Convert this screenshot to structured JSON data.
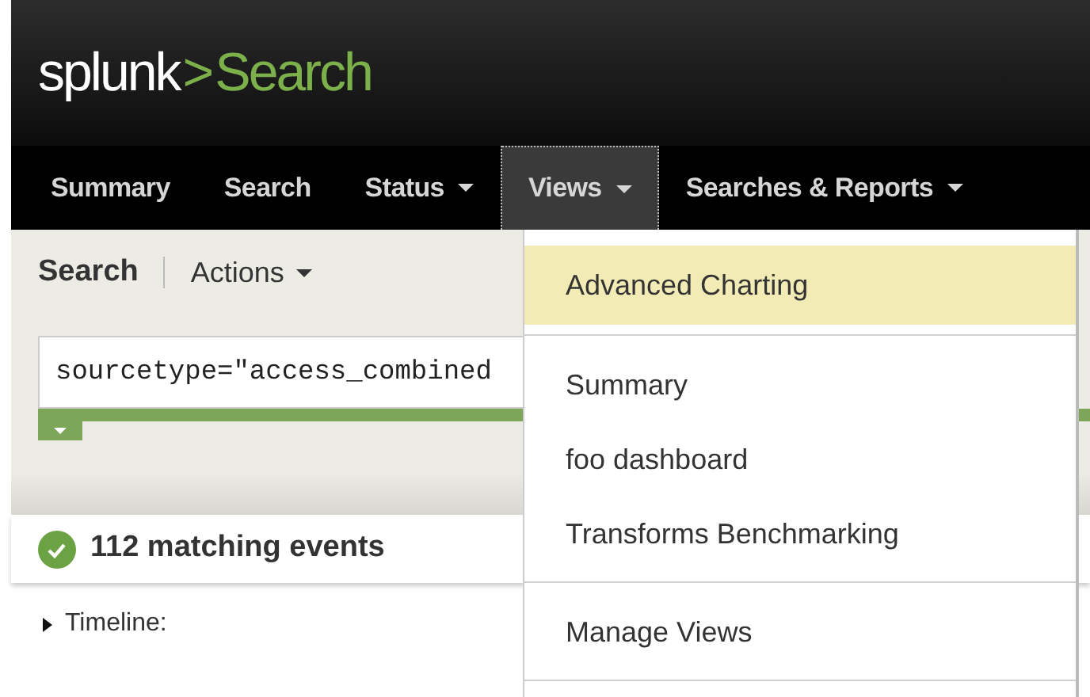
{
  "logo": {
    "brand": "splunk",
    "separator": ">",
    "app": "Search"
  },
  "nav": [
    {
      "label": "Summary",
      "has_menu": false,
      "selected": false
    },
    {
      "label": "Search",
      "has_menu": false,
      "selected": false
    },
    {
      "label": "Status",
      "has_menu": true,
      "selected": false
    },
    {
      "label": "Views",
      "has_menu": true,
      "selected": true
    },
    {
      "label": "Searches & Reports",
      "has_menu": true,
      "selected": false
    }
  ],
  "subheader": {
    "title": "Search",
    "actions": "Actions"
  },
  "search": {
    "value": "sourcetype=\"access_combined"
  },
  "results": {
    "status": "112 matching events"
  },
  "timeline": {
    "label": "Timeline:",
    "expanded": false
  },
  "views_menu": [
    {
      "label": "Advanced Charting",
      "selected": true,
      "divider_after": true
    },
    {
      "label": "Summary",
      "selected": false,
      "divider_after": false
    },
    {
      "label": "foo dashboard",
      "selected": false,
      "divider_after": false
    },
    {
      "label": "Transforms Benchmarking",
      "selected": false,
      "divider_after": true
    },
    {
      "label": "Manage Views",
      "selected": false,
      "divider_after": true
    }
  ]
}
